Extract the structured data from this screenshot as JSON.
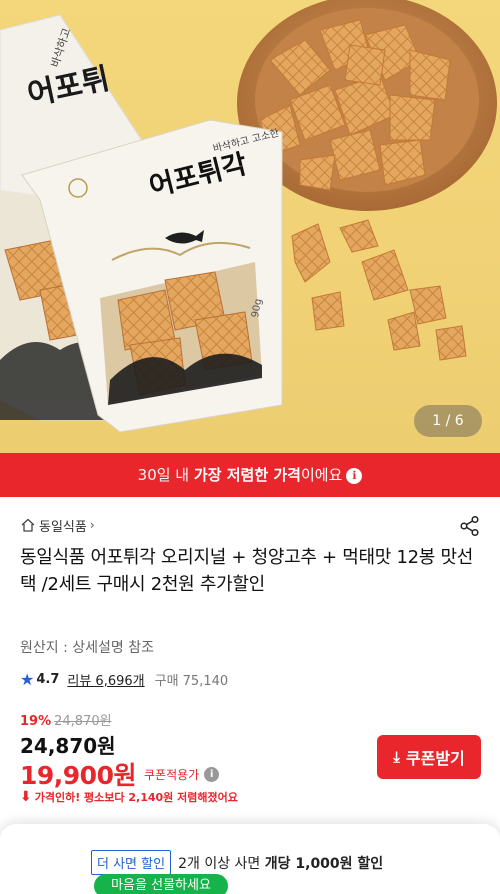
{
  "gallery": {
    "counter": "1 / 6"
  },
  "banner": {
    "prefix": "30일 내 ",
    "highlight": "가장 저렴한 가격",
    "suffix": "이에요",
    "info_icon": "ℹ"
  },
  "store": {
    "name": "동일식품",
    "chevron": "›"
  },
  "product": {
    "title": "동일식품 어포튀각 오리지널 + 청양고추 + 먹태맛 12봉 맛선택 /2세트 구매시 2천원 추가할인",
    "origin": "원산지 : 상세설명 참조",
    "rating": "4.7",
    "reviews": "리뷰 6,696개",
    "sold": "구매 75,140"
  },
  "package": {
    "tagline": "바삭하고 고소한",
    "name": "어포튀각",
    "weight": "90g",
    "tagline_back": "바삭하고",
    "name_back": "어포튀"
  },
  "pricing": {
    "discount": "19%",
    "original": "24,870원",
    "price": "24,870원",
    "coupon_price": "19,900원",
    "coupon_label": "쿠폰적용가",
    "coupon_button": "쿠폰받기",
    "price_drop": "가격인하! 평소보다 2,140원 저렴해졌어요"
  },
  "bundle": {
    "tag": "더 사면 할인",
    "text_prefix": "2개 이상 사면 ",
    "text_bold": "개당 1,000원 할인",
    "gift": "마음을 선물하세요"
  },
  "colors": {
    "accent": "#e8262b",
    "blue": "#2262d8",
    "green": "#16b34a",
    "hero_bg": "#f2d477"
  },
  "icons": [
    "home-icon",
    "share-icon",
    "star-icon",
    "info-icon",
    "download-icon",
    "arrow-down-icon",
    "question-icon"
  ]
}
